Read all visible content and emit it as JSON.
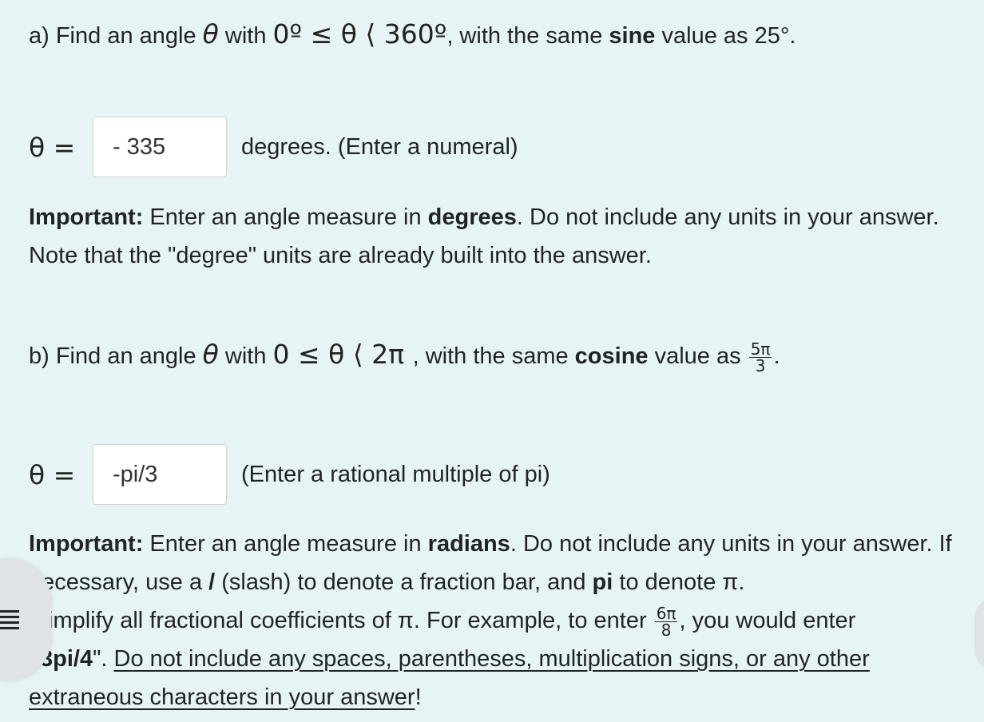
{
  "part_a": {
    "prompt_start": "a) Find an angle ",
    "theta": "θ",
    "with": " with ",
    "range": "0º ≤ θ ⟨ 360º",
    "prompt_mid": ", with the same ",
    "bold_word": "sine",
    "prompt_end": " value as 25°.",
    "theta_eq": "θ =",
    "answer_value": "- 335",
    "hint": "degrees. (Enter a numeral)",
    "important_label": "Important:",
    "important_1": " Enter an angle measure in ",
    "important_bold": "degrees",
    "important_2": ". Do not include any units in your answer. Note that the \"degree\" units are already built into the answer."
  },
  "part_b": {
    "prompt_start": "b) Find an angle ",
    "theta": "θ",
    "with": " with ",
    "range": "0 ≤ θ ⟨ 2π ",
    "prompt_mid": ", with the same ",
    "bold_word": "cosine",
    "prompt_end": " value as ",
    "frac_num": "5π",
    "frac_den": "3",
    "period": ".",
    "theta_eq": "θ =",
    "answer_value": "-pi/3",
    "hint": "(Enter a rational multiple of pi)",
    "important_label": "Important:",
    "important_1": " Enter an angle measure in ",
    "important_bold": "radians",
    "important_2": ". Do not include any units in your answer. If necessary, use a ",
    "slash_bold": "/",
    "important_3": " (slash) to denote a fraction bar, and ",
    "pi_bold": "pi",
    "important_4": " to denote π. ",
    "important_5": "implify all fractional coefficients of π. For example, to enter ",
    "example_num": "6π",
    "example_den": "8",
    "important_6": ", you would enter ",
    "example_answer": "3pi/4",
    "important_7": "\". ",
    "warning": "Do not include any spaces, parentheses, multiplication signs, or any other extraneous characters in your answer",
    "exclaim": "!"
  }
}
